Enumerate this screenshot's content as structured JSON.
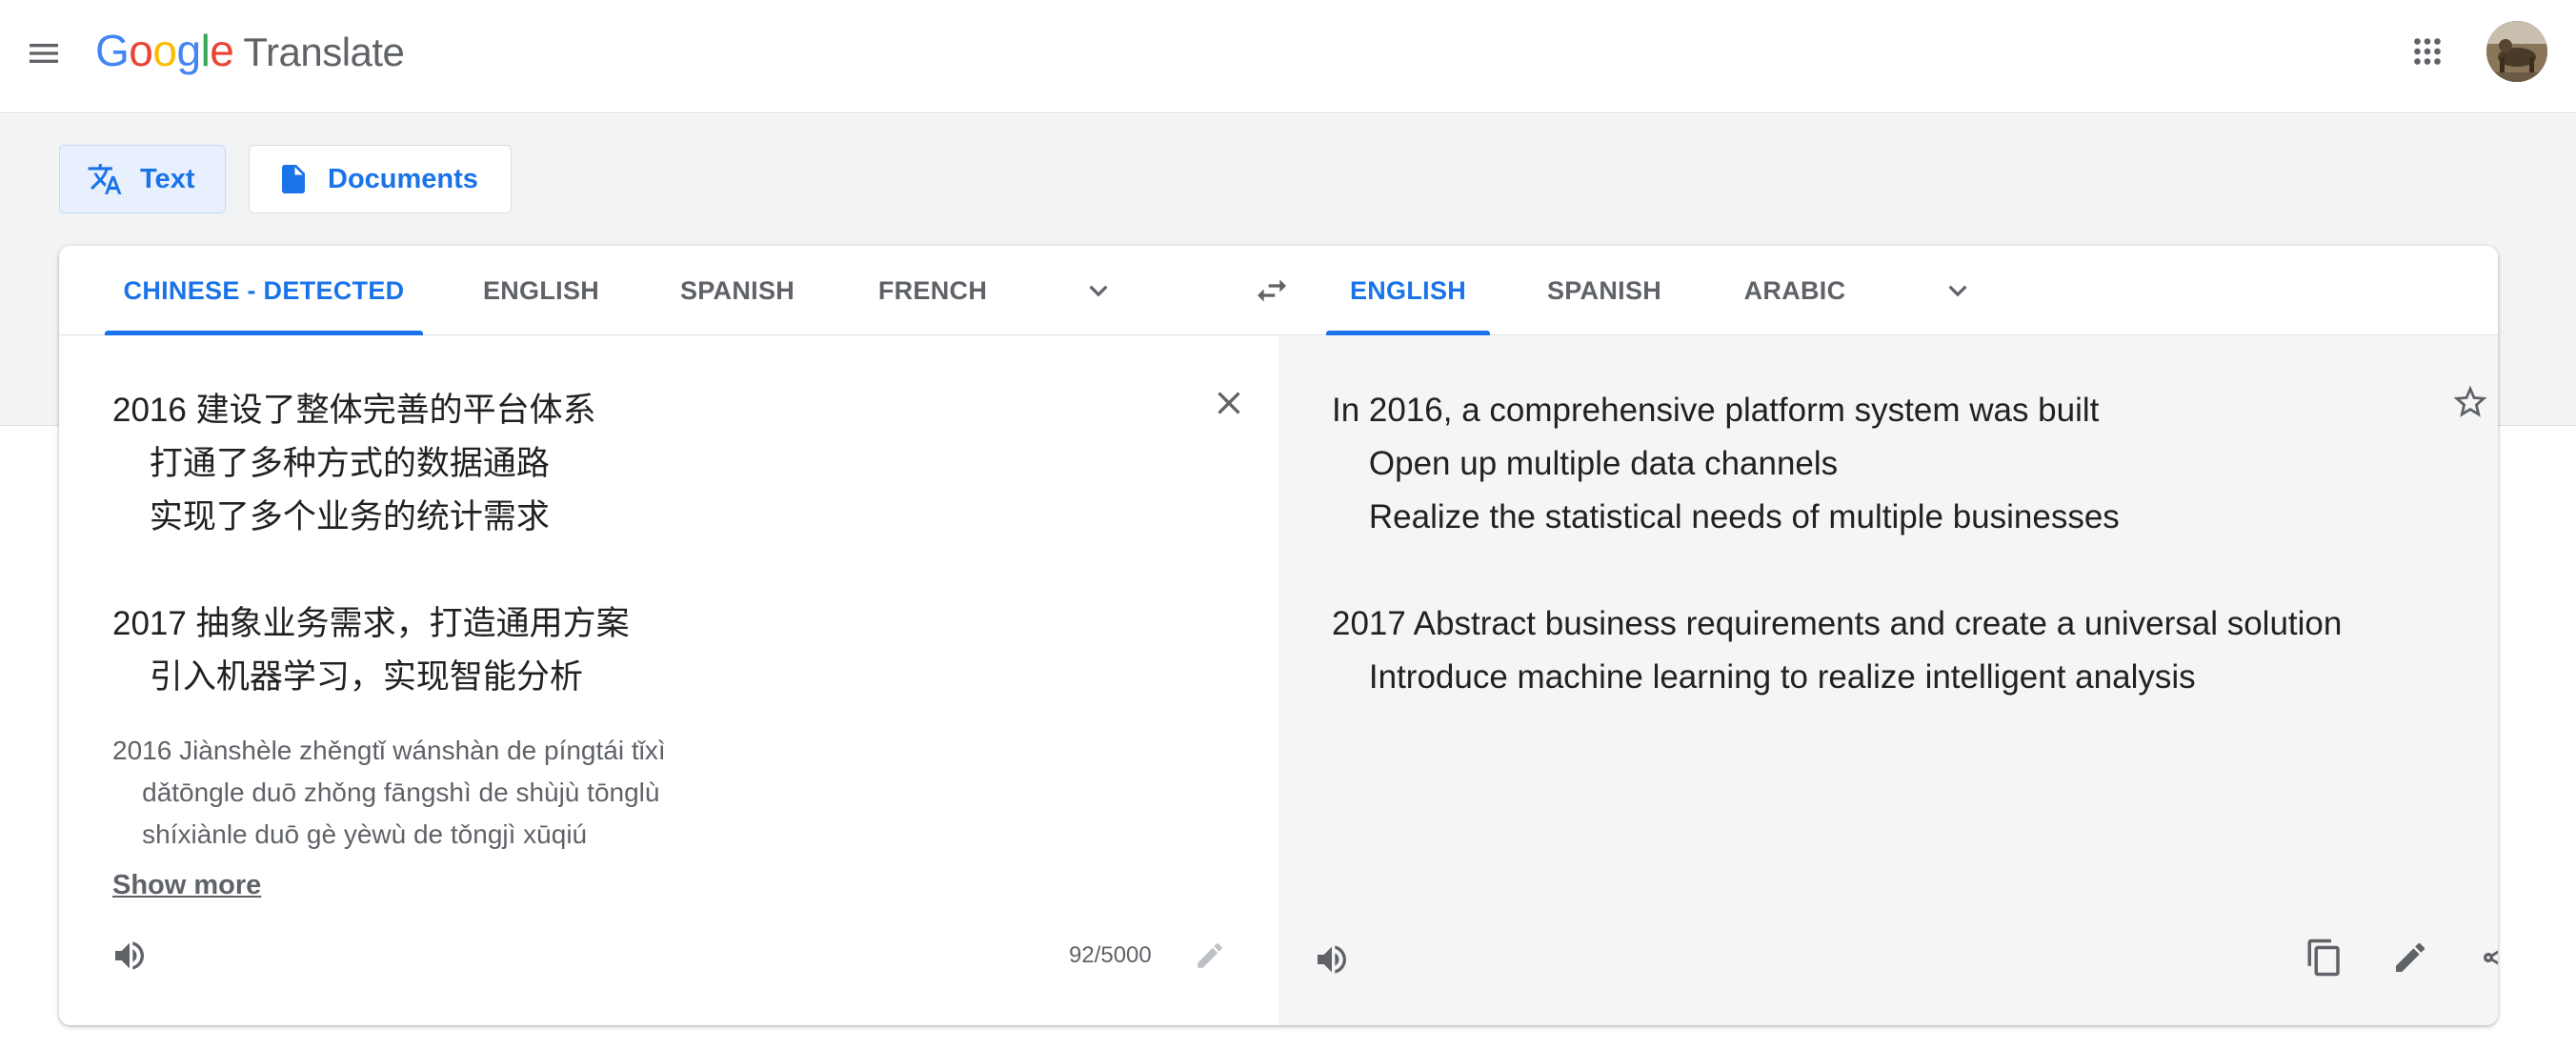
{
  "header": {
    "logo_letters": [
      "G",
      "o",
      "o",
      "g",
      "l",
      "e"
    ],
    "logo_colors": [
      "#4285F4",
      "#EA4335",
      "#FBBC05",
      "#4285F4",
      "#34A853",
      "#EA4335"
    ],
    "product": "Translate",
    "icons": {
      "menu": "menu-icon",
      "apps": "apps-grid-icon",
      "avatar": "user-avatar"
    }
  },
  "modes": {
    "text_label": "Text",
    "documents_label": "Documents",
    "active": "Text"
  },
  "source": {
    "languages": [
      "CHINESE - DETECTED",
      "ENGLISH",
      "SPANISH",
      "FRENCH"
    ],
    "active_language": "CHINESE - DETECTED",
    "lines": [
      "2016 建设了整体完善的平台体系",
      "    打通了多种方式的数据通路",
      "    实现了多个业务的统计需求",
      "",
      "2017 抽象业务需求，打造通用方案",
      "    引入机器学习，实现智能分析"
    ],
    "transliteration": [
      "2016 Jiànshèle zhěngtǐ wánshàn de píngtái tǐxì",
      "    dǎtōngle duō zhǒng fāngshì de shùjù tōnglù",
      "    shíxiànle duō gè yèwù de tǒngjì xūqiú"
    ],
    "show_more": "Show more",
    "char_count": "92/5000"
  },
  "target": {
    "languages": [
      "ENGLISH",
      "SPANISH",
      "ARABIC"
    ],
    "active_language": "ENGLISH",
    "lines": [
      "In 2016, a comprehensive platform system was built",
      "    Open up multiple data channels",
      "    Realize the statistical needs of multiple businesses",
      "",
      "2017 Abstract business requirements and create a universal solution",
      "    Introduce machine learning to realize intelligent analysis"
    ]
  },
  "colors": {
    "accent": "#1a73e8",
    "accent_bg": "#e8f0fe",
    "icon_gray": "#5f6368",
    "band": "#f1f3f4",
    "target_pane": "#f5f5f5"
  }
}
